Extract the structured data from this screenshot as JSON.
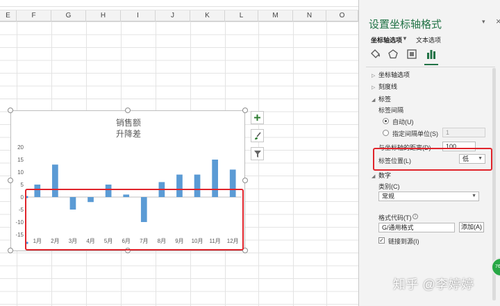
{
  "spreadsheet": {
    "columns": [
      "E",
      "F",
      "G",
      "H",
      "I",
      "J",
      "K",
      "L",
      "M",
      "N",
      "O"
    ]
  },
  "chart": {
    "title_line1": "销售额",
    "title_line2": "升降差",
    "bar_color": "#5b9bd5",
    "highlight_color": "#e0242b"
  },
  "chart_data": {
    "type": "bar",
    "categories": [
      "1月",
      "2月",
      "3月",
      "4月",
      "5月",
      "6月",
      "7月",
      "8月",
      "9月",
      "10月",
      "11月",
      "12月"
    ],
    "values": [
      5,
      13,
      -5,
      -2,
      5,
      1,
      -10,
      6,
      9,
      9,
      15,
      11
    ],
    "yticks": [
      20,
      15,
      10,
      5,
      0,
      -5,
      -10,
      -15
    ],
    "ylim": [
      -20,
      20
    ],
    "grid": false,
    "legend": "none"
  },
  "chart_buttons": {
    "add_icon": "plus-icon",
    "style_icon": "brush-icon",
    "filter_icon": "funnel-icon"
  },
  "pane": {
    "title": "设置坐标轴格式",
    "tab_axis_options": "坐标轴选项",
    "tab_text_options": "文本选项",
    "close": "×",
    "icons": [
      "fill-bucket-icon",
      "pentagon-icon",
      "size-properties-icon",
      "bar-chart-icon"
    ],
    "sections": {
      "axis_options": "坐标轴选项",
      "tick_marks": "刻度线",
      "labels": "标签",
      "number": "数字"
    },
    "label_interval": "标签间隔",
    "auto": "自动(U)",
    "specify_unit": "指定间隔单位(S)",
    "specify_unit_value": "1",
    "distance_from_axis": "与坐标轴的距离(D)",
    "distance_value": "100",
    "label_position": "标签位置(L)",
    "label_position_value": "低",
    "category": "类别(C)",
    "category_value": "常规",
    "format_code": "格式代码(T)",
    "format_code_value": "G/通用格式",
    "add_button": "添加(A)",
    "link_to_source": "链接到源(I)",
    "badge": "76"
  },
  "watermark": "知乎 @李婷婷"
}
